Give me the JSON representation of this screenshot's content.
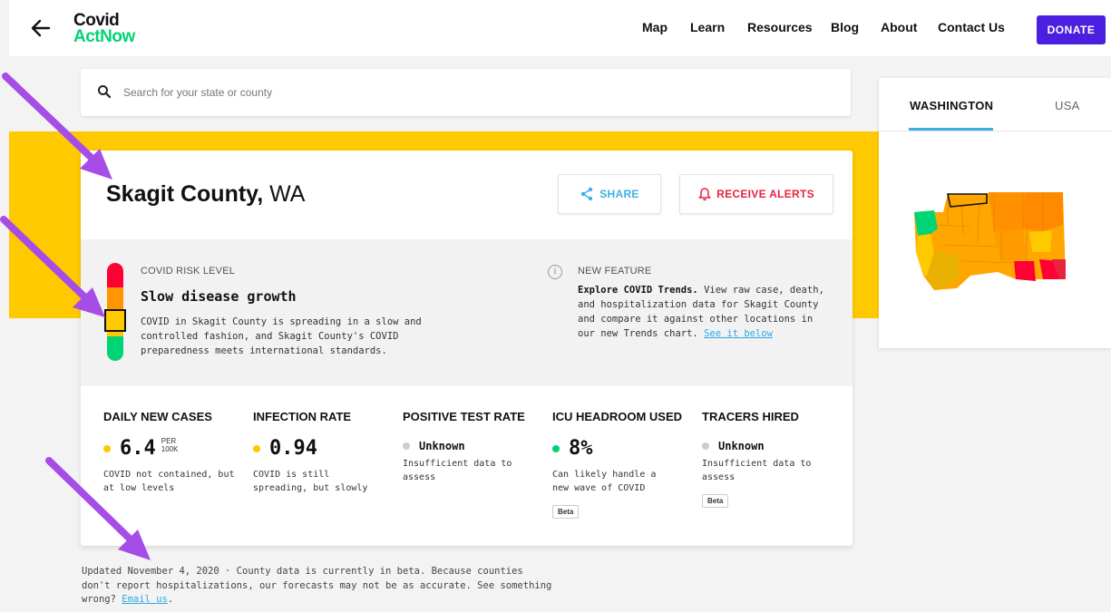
{
  "header": {
    "logo_line1": "Covid",
    "logo_line2": "ActNow",
    "nav": [
      "Map",
      "Learn",
      "Resources",
      "Blog",
      "About",
      "Contact Us"
    ],
    "donate_label": "DONATE"
  },
  "search": {
    "placeholder": "Search for your state or county"
  },
  "location": {
    "county": "Skagit County,",
    "state": "WA"
  },
  "actions": {
    "share_label": "SHARE",
    "alerts_label": "RECEIVE ALERTS"
  },
  "risk": {
    "label": "COVID RISK LEVEL",
    "level": "Slow disease growth",
    "description": "COVID in Skagit County is spreading in a slow and controlled fashion, and Skagit County's COVID preparedness meets international standards.",
    "meter_colors": [
      "#ff0034",
      "#ff9600",
      "#ffc900",
      "#00d474"
    ],
    "selected_level_index": 2
  },
  "new_feature": {
    "label": "NEW FEATURE",
    "bold": "Explore COVID Trends.",
    "text": " View raw case, death, and hospitalization data for Skagit County and compare it against other locations in our new Trends chart.",
    "link": "See it below"
  },
  "metrics": [
    {
      "title": "DAILY NEW CASES",
      "value": "6.4",
      "unit_top": "PER",
      "unit_bottom": "100K",
      "color": "#ffc900",
      "desc": "COVID not contained, but at low levels"
    },
    {
      "title": "INFECTION RATE",
      "value": "0.94",
      "color": "#ffc900",
      "desc": "COVID is still spreading, but slowly"
    },
    {
      "title": "POSITIVE TEST RATE",
      "value": "Unknown",
      "color": "#cccccc",
      "desc": "Insufficient data to assess"
    },
    {
      "title": "ICU HEADROOM USED",
      "value": "8%",
      "color": "#00d474",
      "desc": "Can likely handle a new wave of COVID",
      "badge": "Beta"
    },
    {
      "title": "TRACERS HIRED",
      "value": "Unknown",
      "color": "#cccccc",
      "desc": "Insufficient data to assess",
      "badge": "Beta"
    }
  ],
  "footnote": {
    "text": "Updated November 4, 2020 · County data is currently in beta. Because counties don't report hospitalizations, our forecasts may not be as accurate. See something wrong? ",
    "link": "Email us",
    "end": "."
  },
  "map_panel": {
    "tab_active": "WASHINGTON",
    "tab_inactive": "USA"
  },
  "colors": {
    "brand_green": "#00d474",
    "donate_purple": "#4a1fe0",
    "banner_yellow": "#ffc900",
    "annotation_arrow": "#a64de8",
    "link_blue": "#2ea8e6"
  }
}
